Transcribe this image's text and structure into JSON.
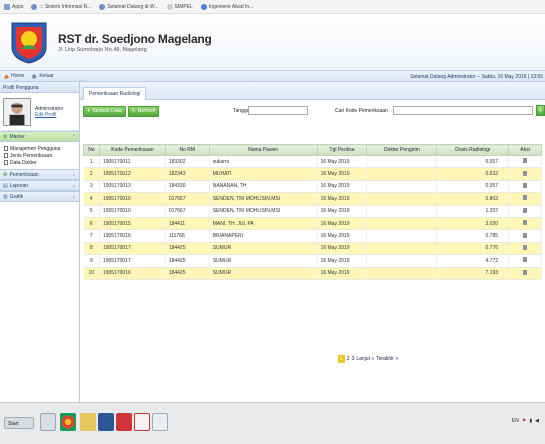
{
  "bookmarks": [
    {
      "label": "Apps",
      "icon": "apps-icon"
    },
    {
      "label": "::: Sistem Informasi R...",
      "icon": "globe-icon"
    },
    {
      "label": "Selamat Datang di W...",
      "icon": "globe-icon"
    },
    {
      "label": "SIMPEL",
      "icon": "globe-icon"
    },
    {
      "label": "Ingenierie Abad In...",
      "icon": "google-icon"
    }
  ],
  "header": {
    "title": "RST dr. Soedjono Magelang",
    "subtitle": "Jl. Urip Sumoharjo No.48, Magelang"
  },
  "menubar": {
    "home": "Home",
    "logout": "Keluar",
    "welcome": "Selamat Datang Adminstrator -- Sabtu, 16 May 2019 | 13:55"
  },
  "sidebar": {
    "profile_title": "Profil Pengguna",
    "user_name": "Adminstrator",
    "edit_profile": "Edit Profil",
    "panels": [
      {
        "label": "Master",
        "active": true,
        "items": [
          "Manajemen Pengguna",
          "Jenis Pemeriksaan",
          "Data Dokter"
        ]
      },
      {
        "label": "Pemeriksaan",
        "active": false
      },
      {
        "label": "Laporan",
        "active": false
      },
      {
        "label": "Grafik",
        "active": false
      }
    ]
  },
  "main": {
    "tab": "Pemeriksaan Radiologi",
    "btn_add": "Tambah Data",
    "btn_refresh": "Refresh",
    "lbl_tanggal": "Tanggal",
    "lbl_cari": "Cari Kode Pemeriksaan",
    "columns": [
      "No",
      "Kode Pemeriksaan",
      "No RM",
      "Nama Pasien",
      "Tgl Periksa",
      "Dokter Pengirim",
      "Dosis Radiologi",
      "Aksi"
    ],
    "rows": [
      [
        "1",
        "1905170011",
        "183302",
        "sukarni",
        "16 May 2019",
        "",
        "0.057"
      ],
      [
        "2",
        "1905170012",
        "182343",
        "MUHATI",
        "16 May 2019",
        "",
        "0.632"
      ],
      [
        "3",
        "1905170013",
        "184330",
        "NANANAN, TH",
        "16 May 2019",
        "",
        "0.057"
      ],
      [
        "4",
        "1905170010",
        "017667",
        "SENDEN, TRI MOHLISIN,MSI",
        "16 May 2019",
        "",
        "0.803"
      ],
      [
        "5",
        "1905170010",
        "017667",
        "SENDEN, TRI MOHLISIN,MSI",
        "16 May 2019",
        "",
        "1.207"
      ],
      [
        "6",
        "1905170015",
        "184411",
        "MANI, TH. JUL PA",
        "16 May 2019",
        "",
        "3.020"
      ],
      [
        "7",
        "1905170016",
        "111766",
        "BRIANAPERI",
        "16 May 2019",
        "",
        "0.785"
      ],
      [
        "8",
        "1905170017",
        "184425",
        "SUMUR",
        "16 May 2019",
        "",
        "0.776"
      ],
      [
        "9",
        "1905170017",
        "184425",
        "SUMUR",
        "16 May 2019",
        "",
        "4.772"
      ],
      [
        "10",
        "1905170016",
        "184425",
        "SUMUR",
        "16 May 2019",
        "",
        "7.193"
      ]
    ],
    "pager": {
      "pages": [
        "1",
        "2",
        "3"
      ],
      "next": "Lanjut »",
      "last": "Terakhir »"
    }
  },
  "taskbar": {
    "start": "Start",
    "tray": "EN"
  },
  "colors": {
    "accent_green": "#4fa93a",
    "alt_row": "#fff6b8",
    "header_blue": "#d8e6f6"
  }
}
